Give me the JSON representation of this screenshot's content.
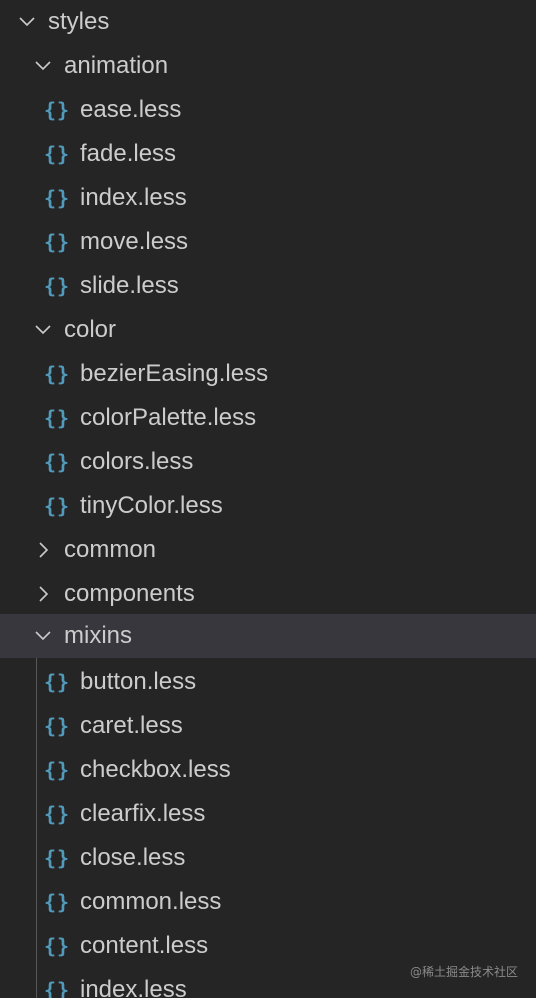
{
  "tree": {
    "root": {
      "label": "styles",
      "icon": "chevron-down-icon"
    },
    "animation": {
      "label": "animation",
      "icon": "chevron-down-icon",
      "files": [
        "ease.less",
        "fade.less",
        "index.less",
        "move.less",
        "slide.less"
      ]
    },
    "color": {
      "label": "color",
      "icon": "chevron-down-icon",
      "files": [
        "bezierEasing.less",
        "colorPalette.less",
        "colors.less",
        "tinyColor.less"
      ]
    },
    "common": {
      "label": "common",
      "icon": "chevron-right-icon"
    },
    "components": {
      "label": "components",
      "icon": "chevron-right-icon"
    },
    "mixins": {
      "label": "mixins",
      "icon": "chevron-down-icon",
      "files": [
        "button.less",
        "caret.less",
        "checkbox.less",
        "clearfix.less",
        "close.less",
        "common.less",
        "content.less",
        "index.less"
      ]
    },
    "file_icon_glyph": "{}",
    "file_icon_name": "less-braces-icon"
  },
  "colors": {
    "background": "#252526",
    "selected_row": "#37373d",
    "text": "#cccccc",
    "file_icon": "#519aba"
  },
  "watermark": "@稀土掘金技术社区"
}
